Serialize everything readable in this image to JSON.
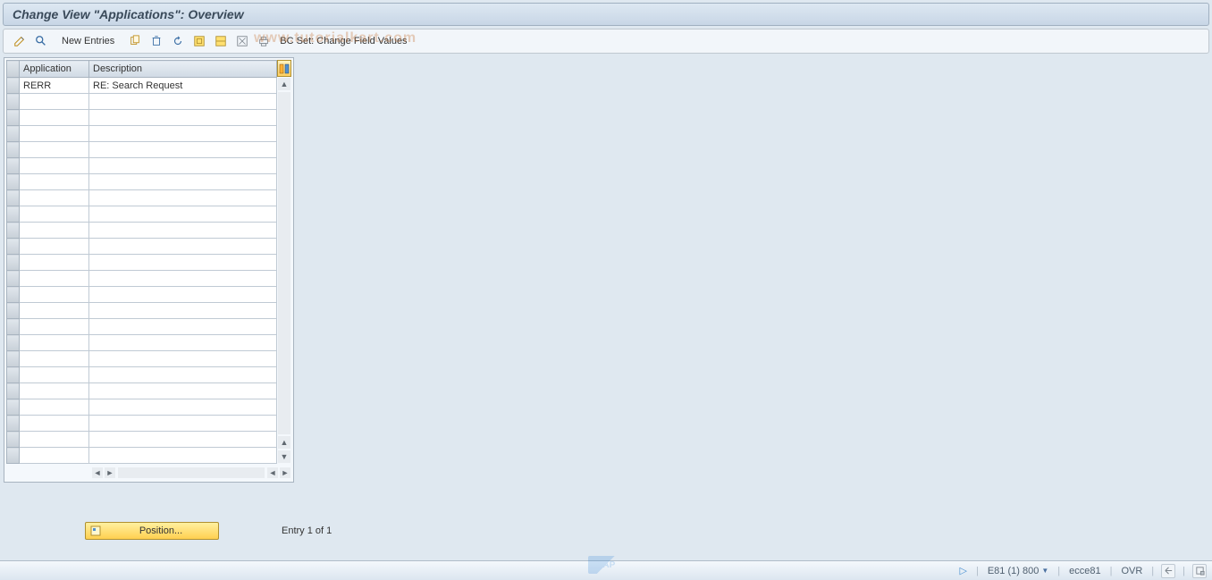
{
  "title": "Change View \"Applications\": Overview",
  "toolbar": {
    "new_entries": "New Entries",
    "bc_set_label": "BC Set: Change Field Values"
  },
  "watermark": "www.tutorialkart.com",
  "table": {
    "columns": {
      "application": "Application",
      "description": "Description"
    },
    "rows": [
      {
        "application": "RERR",
        "description": "RE: Search Request"
      }
    ],
    "visible_row_count": 24
  },
  "footer": {
    "position_btn": "Position...",
    "entry_text": "Entry 1 of 1"
  },
  "statusbar": {
    "session": "E81 (1) 800",
    "server": "ecce81",
    "mode": "OVR"
  }
}
